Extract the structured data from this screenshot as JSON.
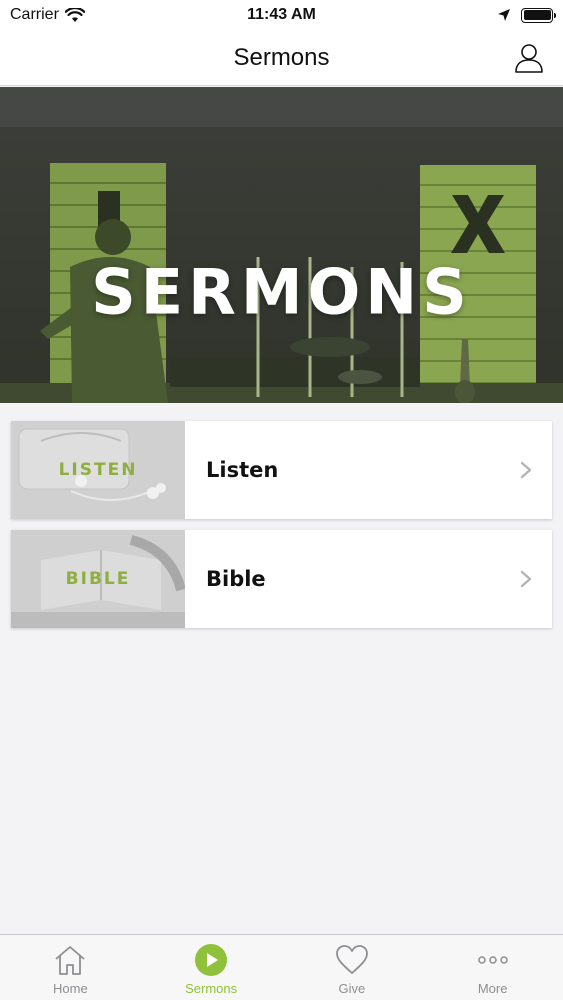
{
  "status_bar": {
    "carrier": "Carrier",
    "time": "11:43 AM"
  },
  "nav": {
    "title": "Sermons"
  },
  "hero": {
    "title": "SERMONS"
  },
  "cards": [
    {
      "thumb_label": "LISTEN",
      "label": "Listen"
    },
    {
      "thumb_label": "BIBLE",
      "label": "Bible"
    }
  ],
  "tabs": [
    {
      "label": "Home",
      "icon": "home-icon"
    },
    {
      "label": "Sermons",
      "icon": "play-icon",
      "active": true
    },
    {
      "label": "Give",
      "icon": "heart-icon"
    },
    {
      "label": "More",
      "icon": "more-icon"
    }
  ],
  "colors": {
    "accent": "#8fc13a",
    "thumb_label": "#8fae3f",
    "inactive_tab": "#8e8e93"
  }
}
